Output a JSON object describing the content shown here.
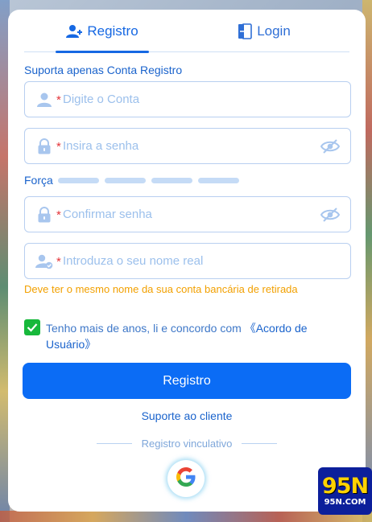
{
  "tabs": {
    "register": "Registro",
    "login": "Login"
  },
  "support_note": "Suporta apenas Conta Registro",
  "fields": {
    "account": {
      "required": "*",
      "placeholder": "Digite o Conta",
      "icon": "user-icon"
    },
    "password": {
      "required": "*",
      "placeholder": "Insira a senha",
      "icon": "lock-icon"
    },
    "confirm": {
      "required": "*",
      "placeholder": "Confirmar senha",
      "icon": "lock-icon"
    },
    "realname": {
      "required": "*",
      "placeholder": "Introduza o seu nome real",
      "icon": "user-check-icon"
    }
  },
  "strength": {
    "label": "Força",
    "bars": 4
  },
  "warning": "Deve ter o mesmo nome da sua conta bancária de retirada",
  "agreement": {
    "checked": true,
    "text": "Tenho mais de anos, li e concordo com ",
    "link": "《Acordo de Usuário》"
  },
  "submit_label": "Registro",
  "support_link": "Suporte ao cliente",
  "bind_label": "Registro vinculativo",
  "social": {
    "google_icon": "google-icon"
  },
  "brand": {
    "big": "95N",
    "small": "95N.COM"
  },
  "colors": {
    "primary": "#0b6cf5",
    "link": "#1a63cc",
    "warning": "#f2a000",
    "check": "#17b83b",
    "required": "#e4363b"
  }
}
